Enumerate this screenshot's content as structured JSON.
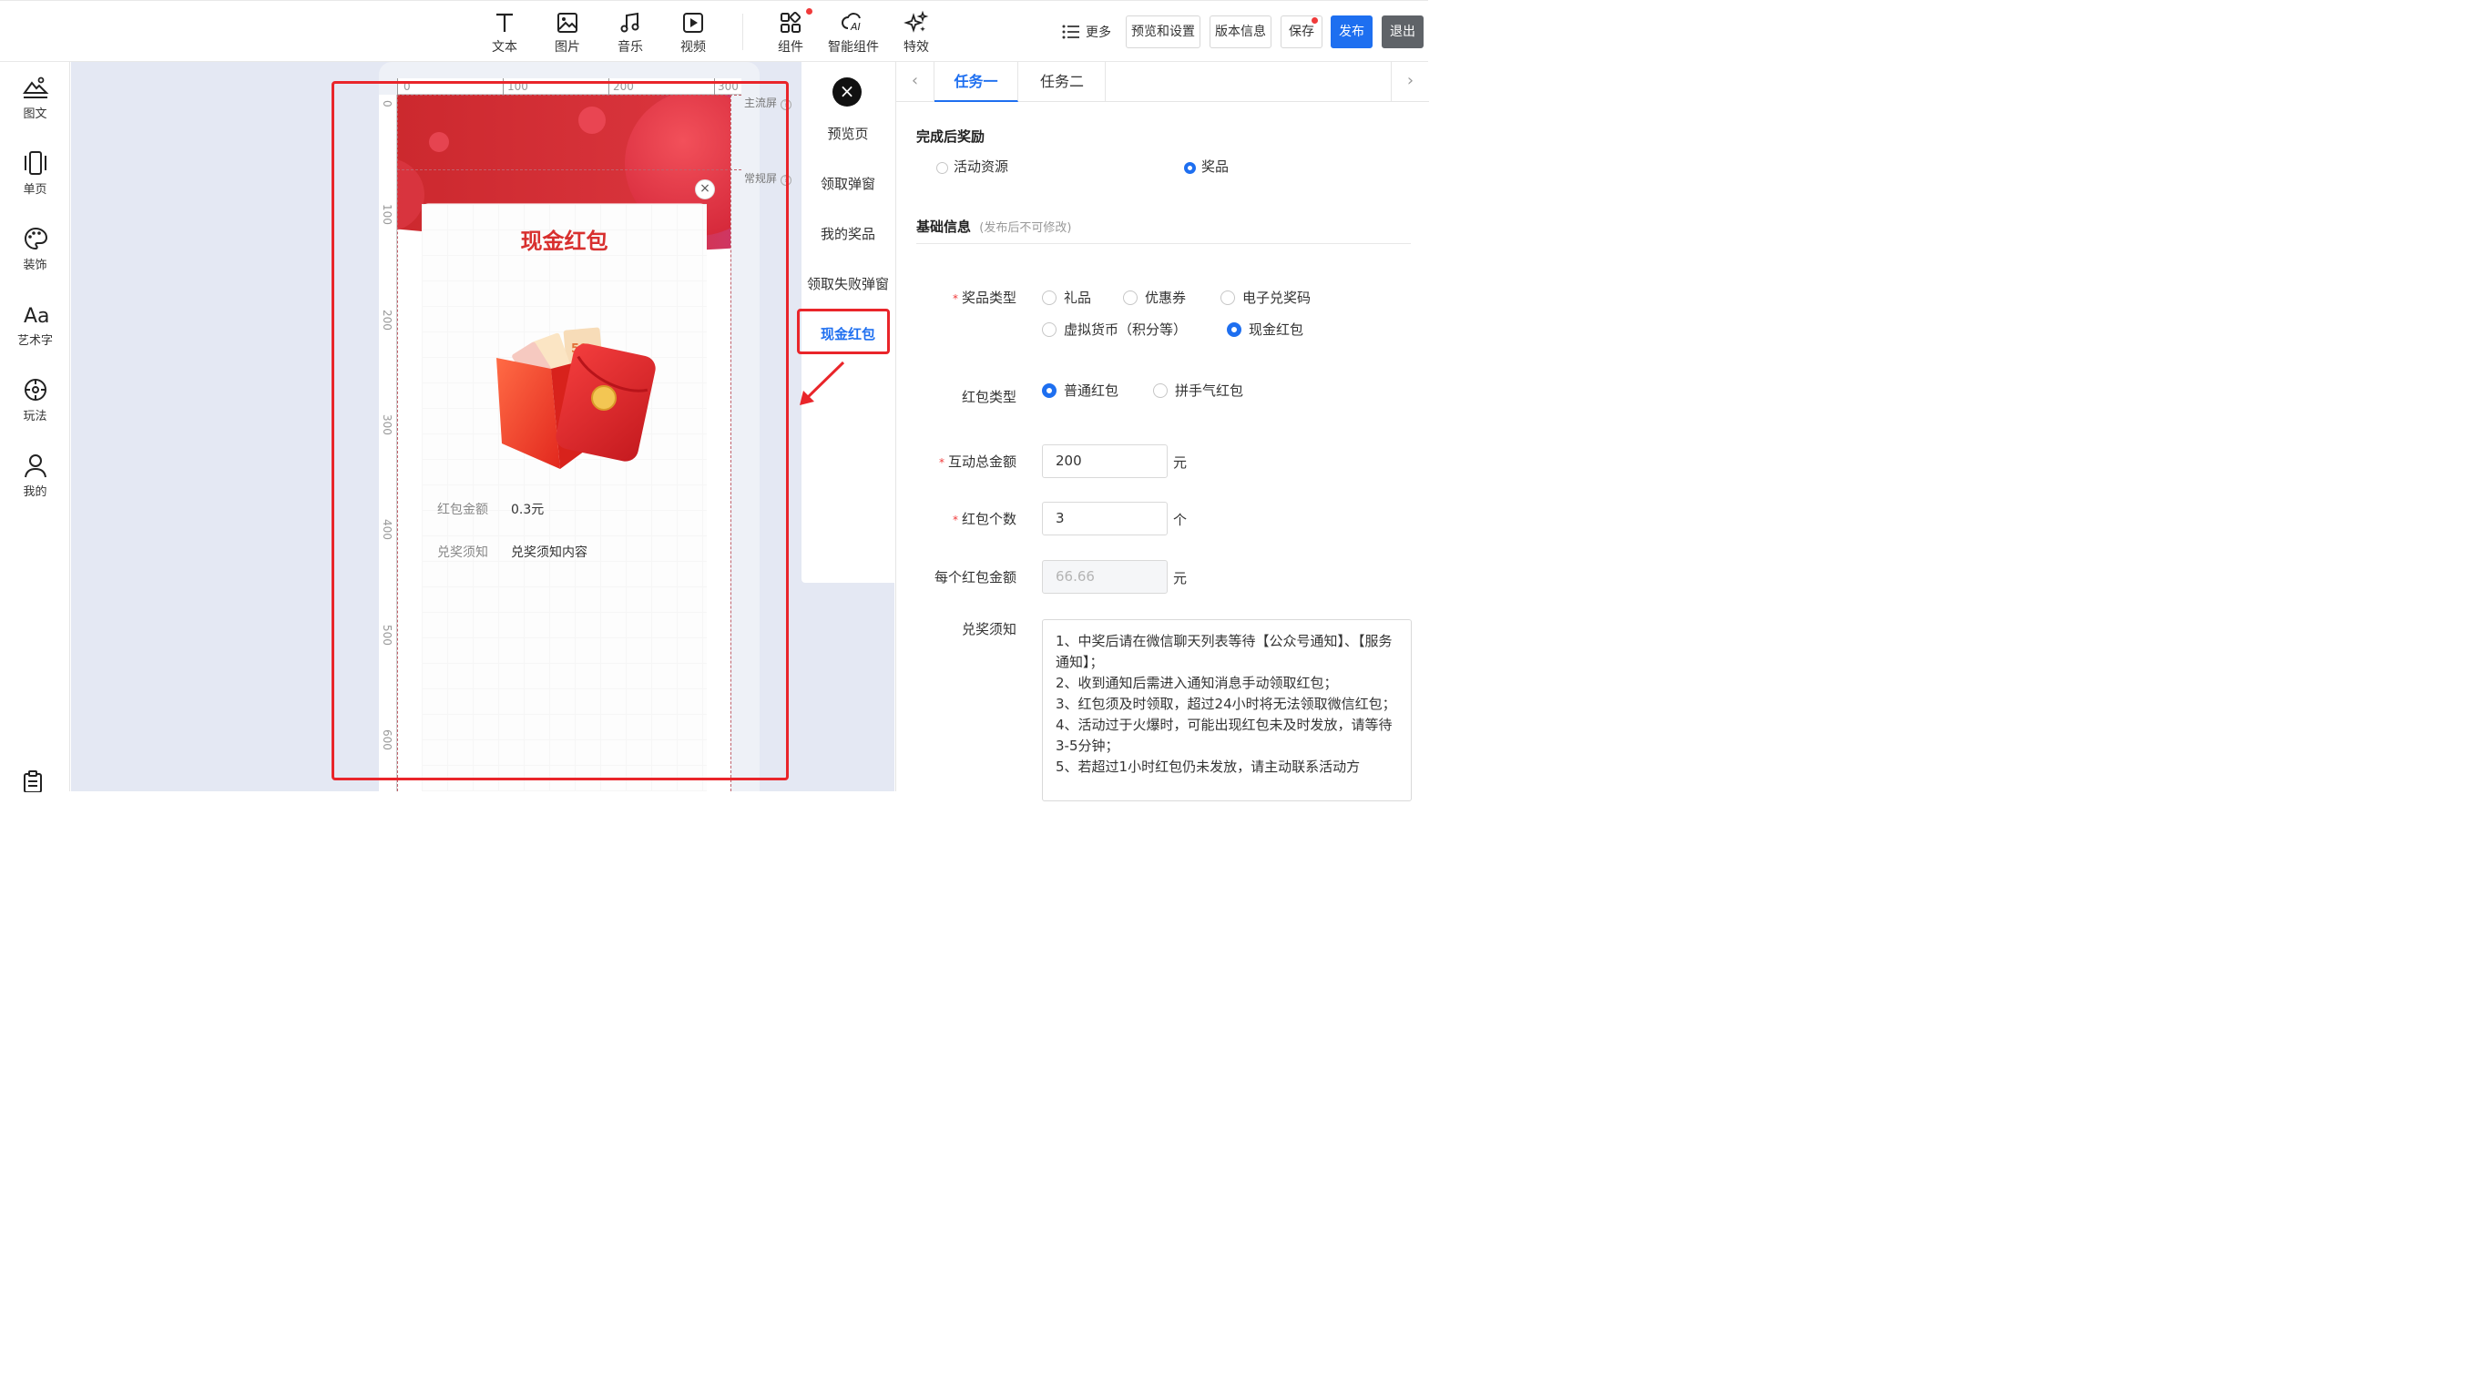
{
  "toolbar": {
    "tools": [
      {
        "label": "文本",
        "icon": "text-icon"
      },
      {
        "label": "图片",
        "icon": "image-icon"
      },
      {
        "label": "音乐",
        "icon": "music-icon"
      },
      {
        "label": "视频",
        "icon": "video-icon"
      },
      {
        "label": "组件",
        "icon": "component-icon",
        "badge": true
      },
      {
        "label": "智能组件",
        "icon": "ai-icon"
      },
      {
        "label": "特效",
        "icon": "sparkle-icon"
      }
    ],
    "more_label": "更多",
    "preview_settings_label": "预览和设置",
    "version_label": "版本信息",
    "save_label": "保存",
    "publish_label": "发布",
    "exit_label": "退出",
    "accent_color": "#1e6ff0",
    "badge_color": "#f03a3a"
  },
  "sidebar": {
    "items": [
      {
        "label": "图文",
        "icon": "image-text-icon"
      },
      {
        "label": "单页",
        "icon": "single-page-icon"
      },
      {
        "label": "装饰",
        "icon": "palette-icon"
      },
      {
        "label": "艺术字",
        "icon": "art-text-icon"
      },
      {
        "label": "玩法",
        "icon": "gameplay-icon"
      },
      {
        "label": "我的",
        "icon": "user-icon"
      }
    ]
  },
  "canvas": {
    "ruler_top": [
      "0",
      "100",
      "200",
      "300"
    ],
    "ruler_left": [
      "0",
      "100",
      "200",
      "300",
      "400",
      "500",
      "600"
    ],
    "main_screen_label": "主流屏",
    "normal_screen_label": "常规屏",
    "card": {
      "title": "现金红包",
      "amount_label": "红包金额",
      "amount_value": "0.3元",
      "notice_label": "兑奖须知",
      "notice_value": "兑奖须知内容"
    }
  },
  "page_list": {
    "items": [
      "预览页",
      "领取弹窗",
      "我的奖品",
      "领取失败弹窗",
      "现金红包"
    ],
    "active_index": 4
  },
  "panel": {
    "tabs": [
      "任务一",
      "任务二"
    ],
    "active_tab": 0,
    "reward_section_title": "完成后奖励",
    "reward_options": [
      "活动资源",
      "奖品"
    ],
    "reward_selected": 1,
    "basic_info_title": "基础信息",
    "basic_info_note": "(发布后不可修改)",
    "prize_type_label": "奖品类型",
    "prize_types": [
      "礼品",
      "优惠券",
      "电子兑奖码",
      "虚拟货币（积分等）",
      "现金红包"
    ],
    "prize_type_selected": 4,
    "redpacket_type_label": "红包类型",
    "redpacket_types": [
      "普通红包",
      "拼手气红包"
    ],
    "redpacket_type_selected": 0,
    "total_amount_label": "互动总金额",
    "total_amount_value": "200",
    "total_amount_unit": "元",
    "count_label": "红包个数",
    "count_value": "3",
    "count_unit": "个",
    "each_amount_label": "每个红包金额",
    "each_amount_value": "66.66",
    "each_amount_unit": "元",
    "notice_label": "兑奖须知",
    "notice_text": "1、中奖后请在微信聊天列表等待【公众号通知】、【服务通知】；\n2、收到通知后需进入通知消息手动领取红包；\n3、红包须及时领取，超过24小时将无法领取微信红包；\n4、活动过于火爆时，可能出现红包未及时发放，请等待3-5分钟；\n5、若超过1小时红包仍未发放，请主动联系活动方"
  }
}
